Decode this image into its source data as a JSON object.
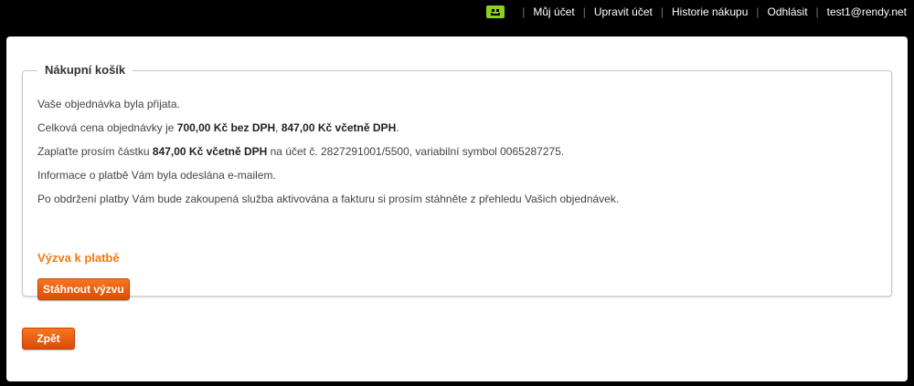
{
  "topnav": {
    "icon": "smiley-icon",
    "links": [
      "Můj účet",
      "Upravit účet",
      "Historie nákupu",
      "Odhlásit"
    ],
    "email": "test1@rendy.net"
  },
  "cart": {
    "title": "Nákupní košík",
    "line1": "Vaše objednávka byla přijata.",
    "line2_pre": "Celková cena objednávky je ",
    "line2_b1": "700,00 Kč bez DPH",
    "line2_mid": ", ",
    "line2_b2": "847,00 Kč včetně DPH",
    "line2_post": ".",
    "line3_pre": "Zaplaťte prosím částku ",
    "line3_b": "847,00 Kč včetně DPH",
    "line3_post": " na účet č. 2827291001/5500, variabilní symbol 0065287275.",
    "line4": "Informace o platbě Vám byla odeslána e-mailem.",
    "line5": "Po obdržení platby Vám bude zakoupená služba aktivována a fakturu si prosím stáhněte z přehledu Vašich objednávek.",
    "payment_link": "Výzva k platbě",
    "download_button": "Stáhnout výzvu"
  },
  "back_button": "Zpět",
  "colors": {
    "accent": "#f07b14",
    "button": "#e85c0d",
    "background": "#000000"
  }
}
